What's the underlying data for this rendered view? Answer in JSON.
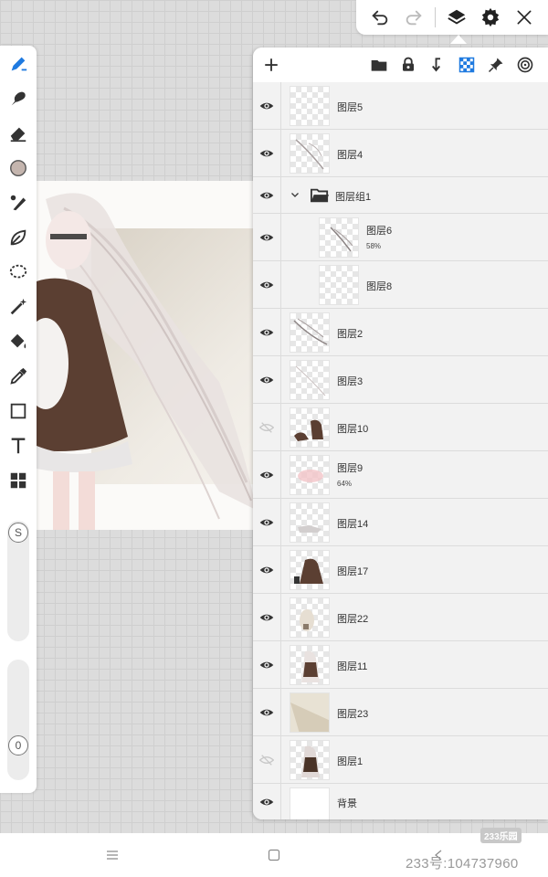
{
  "top_toolbar": {
    "icons": [
      "undo-icon",
      "redo-icon",
      "layers-icon",
      "gear-icon",
      "close-icon"
    ]
  },
  "left_toolbar": {
    "tools": [
      "brush-pen",
      "smudge",
      "eraser",
      "color",
      "brush-settings",
      "leaf-brush",
      "lasso",
      "magic-wand",
      "fill",
      "eyedropper",
      "rectangle",
      "text",
      "tiles"
    ],
    "current_color": "#c4b5ae",
    "size_knob_label": "S",
    "opacity_knob_label": "0"
  },
  "layers_panel": {
    "header_icons": [
      "add-icon",
      "folder-icon",
      "lock-icon",
      "merge-down-icon",
      "transparency-icon",
      "pin-icon",
      "target-icon"
    ],
    "layers": [
      {
        "name": "图层5",
        "visible": true
      },
      {
        "name": "图层4",
        "visible": true
      },
      {
        "name": "图层组1",
        "visible": true,
        "group": true
      },
      {
        "name": "图层6",
        "visible": true,
        "opacity": "58%",
        "child": true
      },
      {
        "name": "图层8",
        "visible": true,
        "child": true
      },
      {
        "name": "图层2",
        "visible": true
      },
      {
        "name": "图层3",
        "visible": true
      },
      {
        "name": "图层10",
        "visible": false
      },
      {
        "name": "图层9",
        "visible": true,
        "opacity": "64%"
      },
      {
        "name": "图层14",
        "visible": true
      },
      {
        "name": "图层17",
        "visible": true
      },
      {
        "name": "图层22",
        "visible": true
      },
      {
        "name": "图层11",
        "visible": true
      },
      {
        "name": "图层23",
        "visible": true
      },
      {
        "name": "图层1",
        "visible": false
      },
      {
        "name": "背景",
        "visible": true
      }
    ]
  },
  "nav": {
    "icons": [
      "menu-icon",
      "home-icon",
      "back-icon"
    ]
  },
  "watermark": {
    "logo_text": "233乐园",
    "id_text": "233号:104737960"
  }
}
